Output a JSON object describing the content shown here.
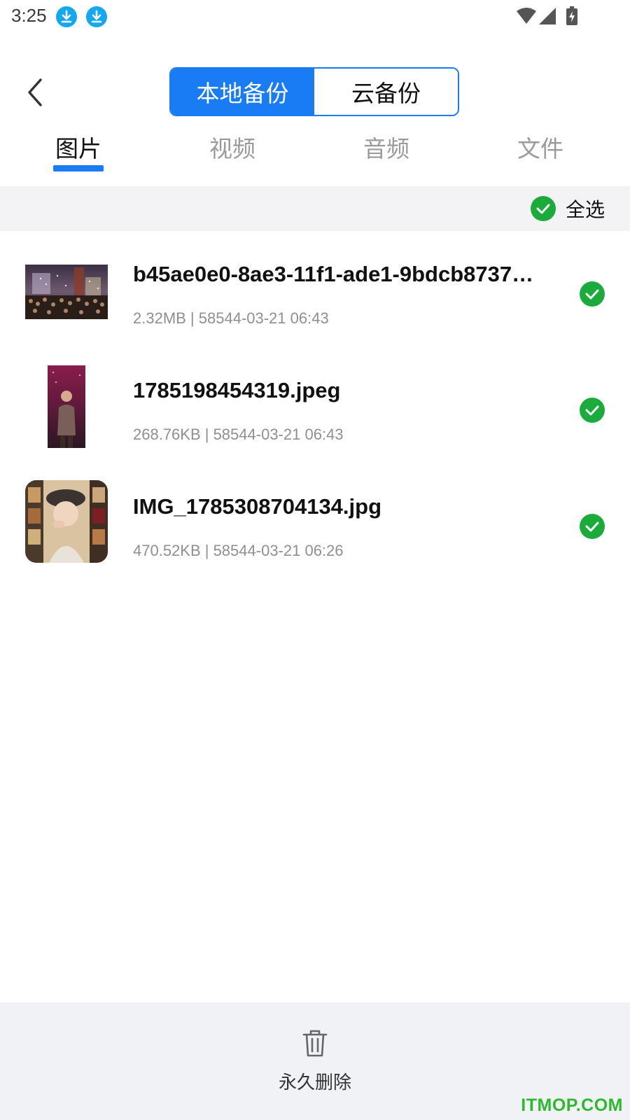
{
  "status_bar": {
    "time": "3:25",
    "icons": [
      "download-icon",
      "download-icon",
      "wifi-icon",
      "cell-signal-icon",
      "battery-charging-icon"
    ]
  },
  "header": {
    "back_icon": "chevron-left-icon",
    "segments": [
      {
        "label": "本地备份",
        "active": true
      },
      {
        "label": "云备份",
        "active": false
      }
    ]
  },
  "tabs": [
    {
      "label": "图片",
      "active": true
    },
    {
      "label": "视频",
      "active": false
    },
    {
      "label": "音频",
      "active": false
    },
    {
      "label": "文件",
      "active": false
    }
  ],
  "select_all": {
    "label": "全选",
    "checked": true
  },
  "files": [
    {
      "name": "b45ae0e0-8ae3-11f1-ade1-9bdcb8737…",
      "meta": "2.32MB | 58544-03-21 06:43",
      "checked": true
    },
    {
      "name": "1785198454319.jpeg",
      "meta": "268.76KB | 58544-03-21 06:43",
      "checked": true
    },
    {
      "name": "IMG_1785308704134.jpg",
      "meta": "470.52KB | 58544-03-21 06:26",
      "checked": true
    }
  ],
  "bottom_bar": {
    "delete_label": "永久删除",
    "delete_icon": "trash-icon"
  },
  "watermark": "ITMOP.COM",
  "colors": {
    "accent": "#1a7cf5",
    "check_green": "#1aab3a",
    "download_blue": "#14a8f0",
    "watermark_green": "#2eb82e"
  }
}
